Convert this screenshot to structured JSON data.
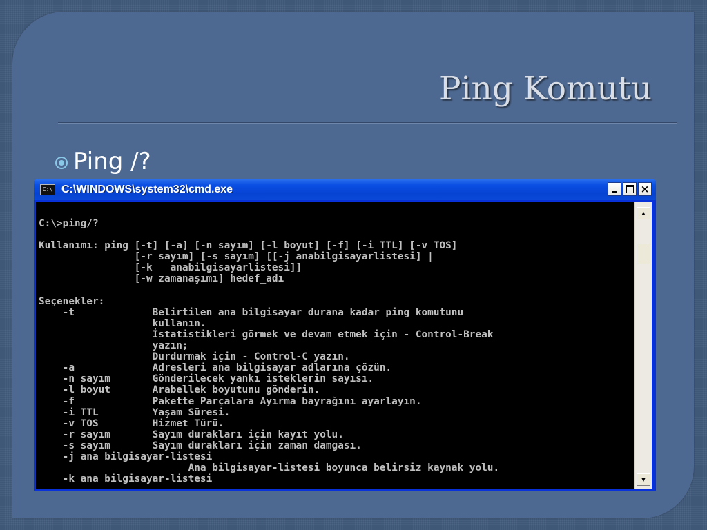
{
  "slide": {
    "title": "Ping Komutu",
    "bullet": "Ping /?"
  },
  "window": {
    "title": "C:\\WINDOWS\\system32\\cmd.exe",
    "icon": "cmd-icon",
    "buttons": {
      "minimize": "minimize-icon",
      "maximize": "maximize-icon",
      "close": "×"
    }
  },
  "console": {
    "lines": [
      "C:\\>ping/?",
      "",
      "Kullanımı: ping [-t] [-a] [-n sayım] [-l boyut] [-f] [-i TTL] [-v TOS]",
      "                [-r sayım] [-s sayım] [[-j anabilgisayarlistesi] |",
      "                [-k   anabilgisayarlistesi]]",
      "                [-w zamanaşımı] hedef_adı",
      "",
      "Seçenekler:",
      "    -t             Belirtilen ana bilgisayar durana kadar ping komutunu",
      "                   kullanın.",
      "                   İstatistikleri görmek ve devam etmek için - Control-Break",
      "                   yazın;",
      "                   Durdurmak için - Control-C yazın.",
      "    -a             Adresleri ana bilgisayar adlarına çözün.",
      "    -n sayım       Gönderilecek yankı isteklerin sayısı.",
      "    -l boyut       Arabellek boyutunu gönderin.",
      "    -f             Pakette Parçalara Ayırma bayrağını ayarlayın.",
      "    -i TTL         Yaşam Süresi.",
      "    -v TOS         Hizmet Türü.",
      "    -r sayım       Sayım durakları için kayıt yolu.",
      "    -s sayım       Sayım durakları için zaman damgası.",
      "    -j ana bilgisayar-listesi",
      "                         Ana bilgisayar-listesi boyunca belirsiz kaynak yolu.",
      "    -k ana bilgisayar-listesi"
    ]
  },
  "colors": {
    "slide_bg": "#4e6991",
    "console_bg": "#000000",
    "console_text": "#c0c0c0",
    "titlebar": "#0a4ee3"
  }
}
